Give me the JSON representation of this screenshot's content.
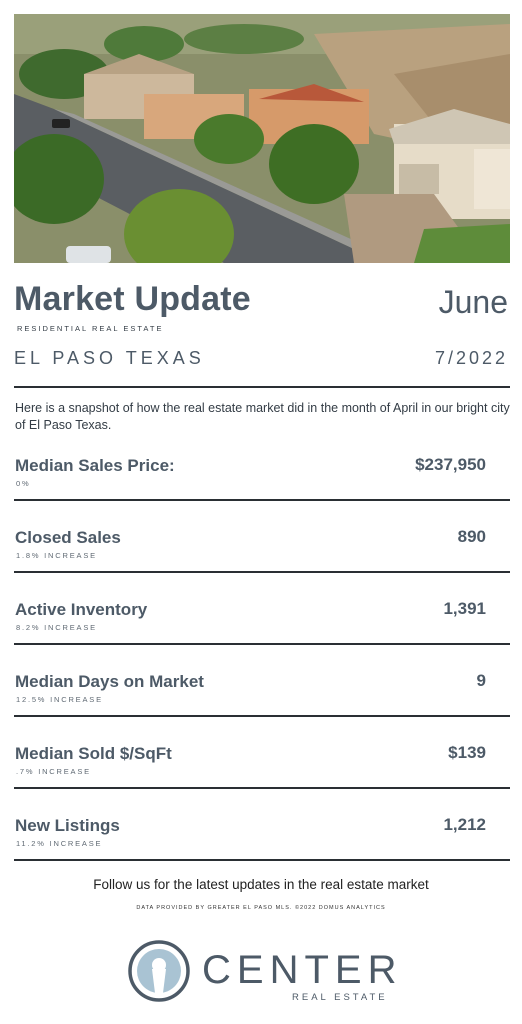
{
  "header": {
    "title": "Market Update",
    "month": "June",
    "subtitle": "RESIDENTIAL REAL ESTATE",
    "city": "EL PASO TEXAS",
    "date": "7/2022"
  },
  "intro": "Here is a snapshot of how the real estate market did in the month of April in our bright city of El Paso Texas.",
  "stats": [
    {
      "label": "Median Sales Price:",
      "value": "$237,950",
      "change": "0%"
    },
    {
      "label": "Closed Sales",
      "value": "890",
      "change": "1.8% INCREASE"
    },
    {
      "label": "Active Inventory",
      "value": "1,391",
      "change": "8.2% INCREASE"
    },
    {
      "label": "Median Days on Market",
      "value": "9",
      "change": "12.5% INCREASE"
    },
    {
      "label": "Median Sold $/SqFt",
      "value": "$139",
      "change": ".7% INCREASE"
    },
    {
      "label": "New Listings",
      "value": "1,212",
      "change": "11.2% INCREASE"
    }
  ],
  "footer": {
    "follow": "Follow us for the latest updates in the real estate market",
    "credit": "DATA PROVIDED BY GREATER EL PASO MLS. ©2022 DOMUS ANALYTICS"
  },
  "logo": {
    "word": "CENTER",
    "sub": "REAL ESTATE"
  },
  "colors": {
    "text": "#4d5a67",
    "rule": "#2a2f34",
    "logo_accent": "#a9c3d3"
  }
}
